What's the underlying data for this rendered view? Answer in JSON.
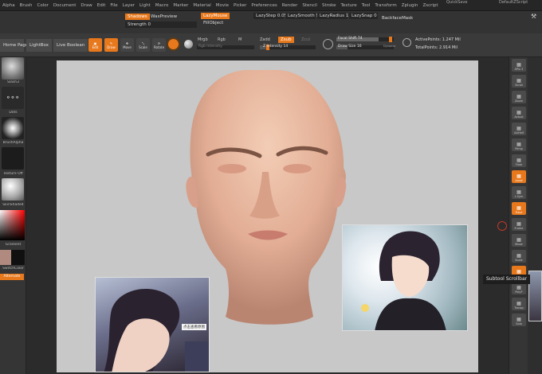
{
  "topbar_right": {
    "left_label": "QuickSave",
    "right_label": "DefaultZScript"
  },
  "menu": [
    "Alpha",
    "Brush",
    "Color",
    "Document",
    "Draw",
    "Edit",
    "File",
    "Layer",
    "Light",
    "Macro",
    "Marker",
    "Material",
    "Movie",
    "Picker",
    "Preferences",
    "Render",
    "Stencil",
    "Stroke",
    "Texture",
    "Tool",
    "Transform",
    "Zplugin",
    "Zscript"
  ],
  "options": {
    "shadows": "Shadows",
    "wax_preview": "WaxPreview",
    "strength": "Strength 0",
    "lazy_mouse": "LazyMouse",
    "fill_object": "FillObject",
    "lazy_step": "LazyStep 0.0595",
    "lazy_smooth": "LazySmooth 9",
    "lazy_radius": "LazyRadius 1",
    "lazy_snap": "LazySnap 0",
    "backface_mask": "BackfaceMask"
  },
  "toolbar": {
    "home_page": "Home Page",
    "lightbox": "LightBox",
    "live_boolean": "Live Boolean",
    "edit": "Edit",
    "draw": "Draw",
    "move": "Move",
    "scale": "Scale",
    "rotate": "Rotate",
    "mrgb": "Mrgb",
    "rgb": "Rgb",
    "m": "M",
    "rgb_intensity": "Rgb Intensity",
    "zadd": "Zadd",
    "zsub": "Zsub",
    "zcut": "Zcut",
    "z_intensity": "Z Intensity 14",
    "focal_shift": "Focal Shift 74",
    "draw_size": "Draw Size 16",
    "dynamic": "Dynamic",
    "active_points": "ActivePoints: 1.247 Mil",
    "total_points": "TotalPoints: 2.914 Mil"
  },
  "left_shelf": {
    "brush": "Slash3",
    "stroke": "Dots",
    "alpha": "BrushAlpha",
    "texture": "Texture Off",
    "material": "SkinShade4",
    "gradient": "Gradient",
    "switch_color": "SwitchColor",
    "alternate": "Alternate",
    "main_color": "#b08a7e",
    "secondary_color": "#101010"
  },
  "right_shelf": [
    {
      "label": "SPix 3"
    },
    {
      "label": "Scroll"
    },
    {
      "label": "Zoom"
    },
    {
      "label": "Actual"
    },
    {
      "label": "AAHalf"
    },
    {
      "label": "Persp"
    },
    {
      "label": "Floor"
    },
    {
      "label": "Local"
    },
    {
      "label": "L.Sym"
    },
    {
      "label": "Gxyz"
    },
    {
      "label": "Frame"
    },
    {
      "label": "Move"
    },
    {
      "label": "Scale"
    },
    {
      "label": "Rotate"
    },
    {
      "label": "PolyF"
    },
    {
      "label": "Transp"
    },
    {
      "label": "Solo"
    }
  ],
  "tooltip": "Subtool Scrollbar",
  "photo_caption": "点击查看原图"
}
